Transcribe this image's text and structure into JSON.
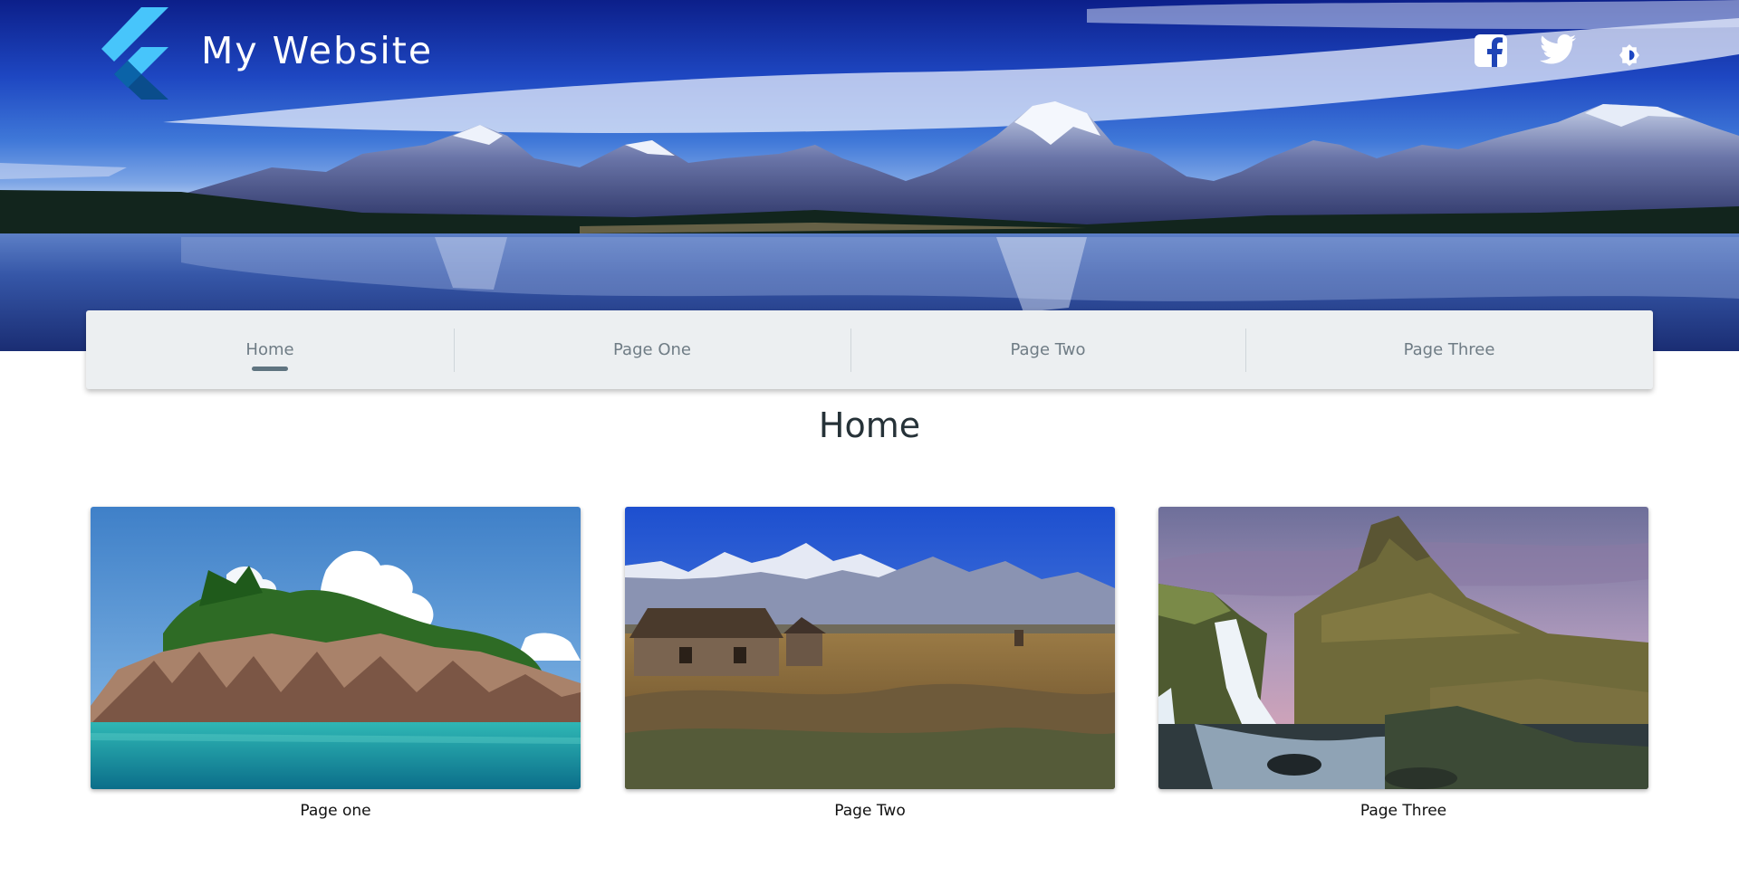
{
  "header": {
    "title": "My Website",
    "logo_icon": "flutter-logo-icon",
    "social": [
      {
        "name": "facebook-icon"
      },
      {
        "name": "twitter-icon"
      }
    ],
    "theme_toggle_icon": "brightness-icon"
  },
  "nav": {
    "items": [
      {
        "label": "Home",
        "active": true
      },
      {
        "label": "Page One",
        "active": false
      },
      {
        "label": "Page Two",
        "active": false
      },
      {
        "label": "Page Three",
        "active": false
      }
    ]
  },
  "main": {
    "title": "Home",
    "cards": [
      {
        "caption": "Page one",
        "image": "tropical-island-image"
      },
      {
        "caption": "Page Two",
        "image": "prairie-cabin-mountains-image"
      },
      {
        "caption": "Page Three",
        "image": "waterfall-mountain-image"
      }
    ]
  },
  "colors": {
    "nav_background": "#eceff1",
    "nav_text": "#6f7c85",
    "nav_indicator": "#5f7480",
    "title_text": "#263238",
    "logo_light": "#47c5fb",
    "logo_dark": "#0a4d8c"
  }
}
